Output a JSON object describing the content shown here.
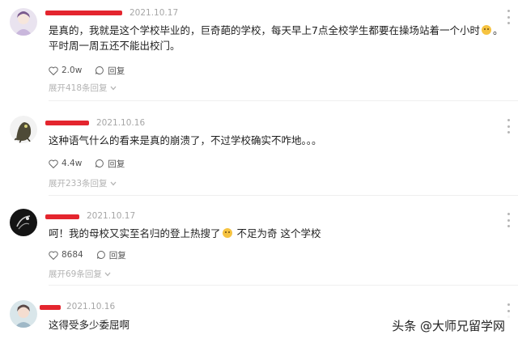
{
  "comments": [
    {
      "date": "2021.10.17",
      "text_a": "是真的，我就是这个学校毕业的，巨奇葩的学校，每天早上7点全校学生都要在操场站着一个小时",
      "text_b": "。平时周一周五还不能出校门。",
      "likes": "2.0w",
      "reply_label": "回复",
      "expand": "展开418条回复"
    },
    {
      "date": "2021.10.16",
      "text": "这种语气什么的看来是真的崩溃了，不过学校确实不咋地。。。",
      "likes": "4.4w",
      "reply_label": "回复",
      "expand": "展开233条回复"
    },
    {
      "date": "2021.10.17",
      "text_a": "呵！我的母校又实至名归的登上热搜了",
      "text_b": "不足为奇 这个学校",
      "likes": "8684",
      "reply_label": "回复",
      "expand": "展开69条回复"
    },
    {
      "date": "2021.10.16",
      "text": "这得受多少委屈啊"
    }
  ],
  "watermark": "头条 @大师兄留学网",
  "colors": {
    "name_redaction": "#e4252e",
    "meta": "#a6a6a6"
  },
  "icons": [
    "heart-icon",
    "comment-icon",
    "more-options-icon",
    "chevron-down-icon",
    "emoji-icon"
  ]
}
